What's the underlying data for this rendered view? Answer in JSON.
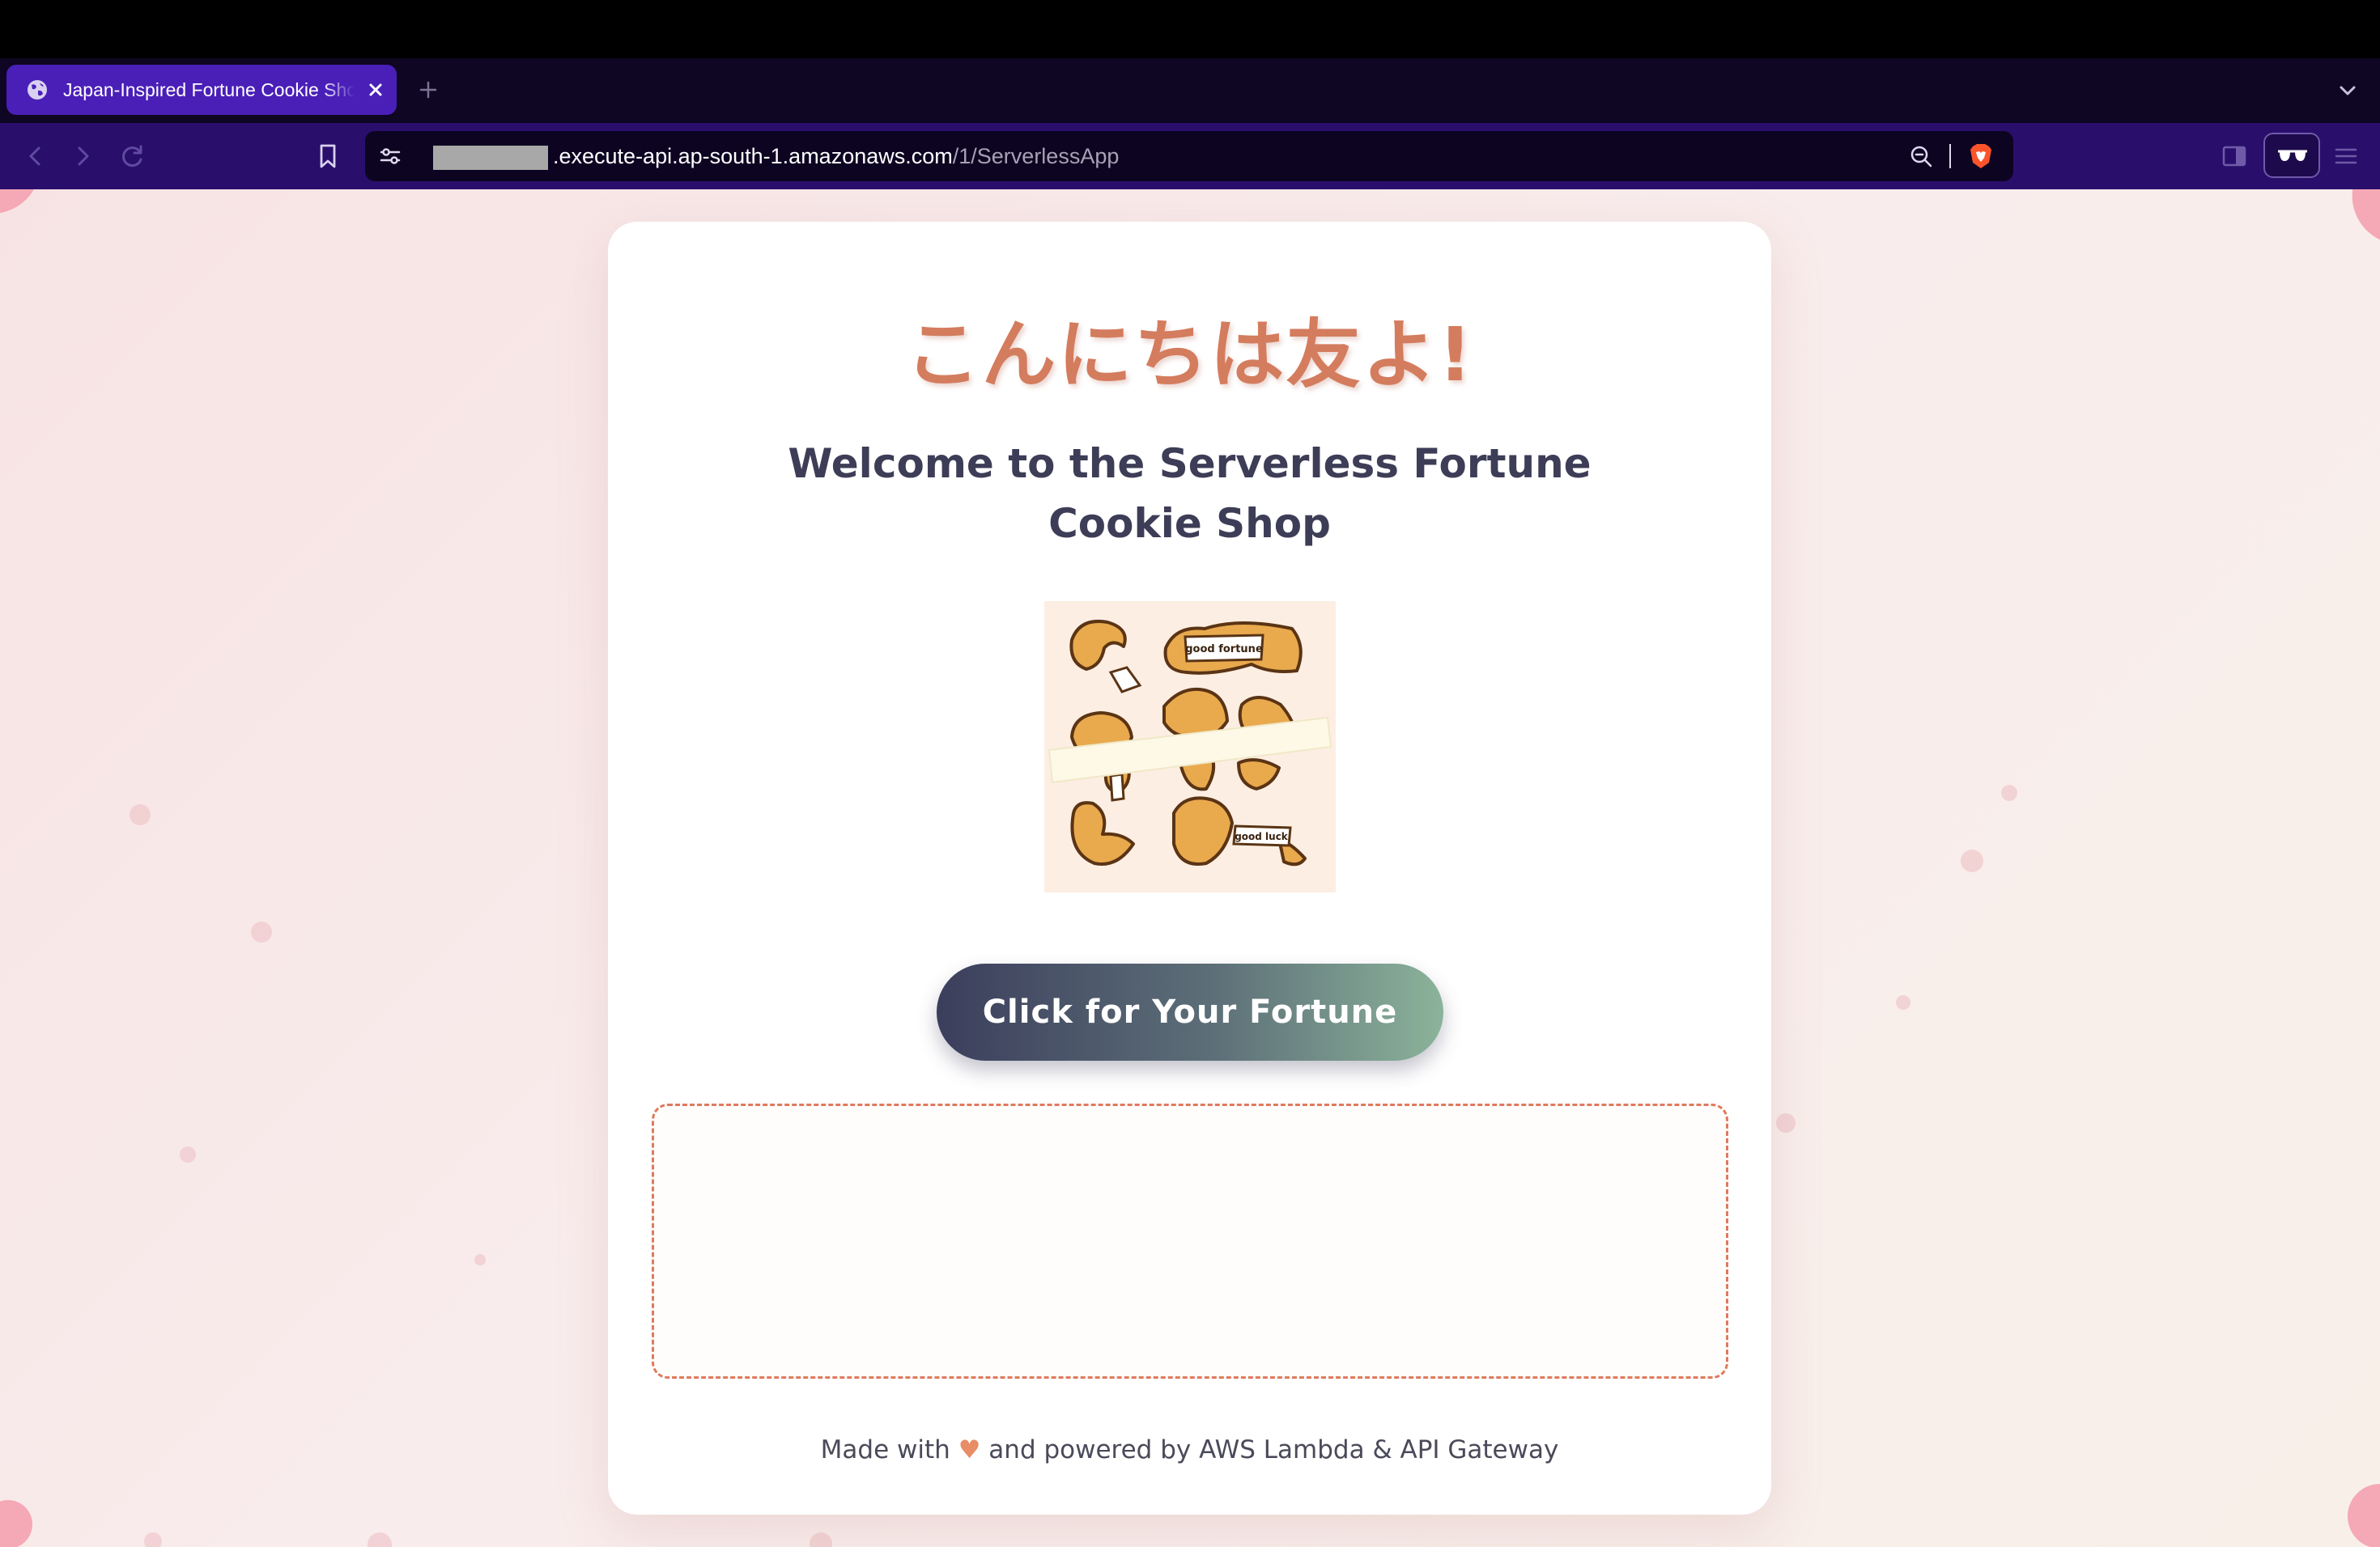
{
  "browser": {
    "tab": {
      "title": "Japan-Inspired Fortune Cookie Shop",
      "icon": "globe-icon",
      "close_icon": "close-icon"
    },
    "new_tab_icon": "plus-icon",
    "tab_list_icon": "chevron-down-icon",
    "toolbar": {
      "back_icon": "chevron-left-icon",
      "forward_icon": "chevron-right-icon",
      "reload_icon": "reload-icon",
      "bookmark_icon": "bookmark-icon",
      "site_settings_icon": "sliders-icon",
      "zoom_icon": "zoom-icon",
      "brave_shield_icon": "shield-icon",
      "sidebar_icon": "sidebar-icon",
      "reader_mode_icon": "glasses-icon",
      "menu_icon": "menu-icon"
    },
    "url": {
      "host": ".execute-api.ap-south-1.amazonaws.com",
      "path": "/1/ServerlessApp"
    }
  },
  "page": {
    "jp_title": "こんにちは友よ!",
    "welcome": "Welcome to the Serverless Fortune Cookie Shop",
    "image_labels": {
      "top": "good fortune",
      "bottom": "good luck"
    },
    "button_label": "Click for Your Fortune",
    "fortune_text": "",
    "footer": {
      "prefix": "Made with",
      "heart": "♥",
      "suffix": "and powered by AWS Lambda & API Gateway"
    }
  },
  "colors": {
    "accent": "#d47c5e",
    "heading": "#3d3d57",
    "tab_active": "#4a1fb8",
    "toolbar": "#2a0e6b"
  }
}
